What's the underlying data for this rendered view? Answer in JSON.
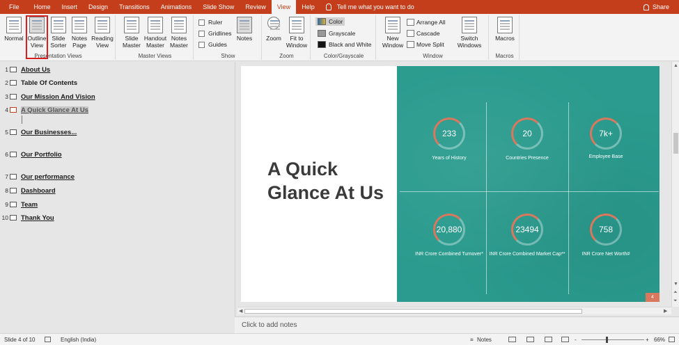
{
  "tabs": [
    "File",
    "Home",
    "Insert",
    "Design",
    "Transitions",
    "Animations",
    "Slide Show",
    "Review",
    "View",
    "Help"
  ],
  "active_tab": "View",
  "tell_me": "Tell me what you want to do",
  "share": "Share",
  "ribbon": {
    "presentation_views": {
      "label": "Presentation Views",
      "buttons": [
        "Normal",
        "Outline View",
        "Slide Sorter",
        "Notes Page",
        "Reading View"
      ]
    },
    "master_views": {
      "label": "Master Views",
      "buttons": [
        "Slide Master",
        "Handout Master",
        "Notes Master"
      ]
    },
    "show": {
      "label": "Show",
      "checkboxes": [
        "Ruler",
        "Gridlines",
        "Guides"
      ],
      "notes": "Notes"
    },
    "zoom": {
      "label": "Zoom",
      "zoom": "Zoom",
      "fit": "Fit to Window"
    },
    "color": {
      "label": "Color/Grayscale",
      "options": [
        "Color",
        "Grayscale",
        "Black and White"
      ]
    },
    "window": {
      "label": "Window",
      "new_window": "New Window",
      "arrange_all": "Arrange All",
      "cascade": "Cascade",
      "move_split": "Move Split",
      "switch_windows": "Switch Windows"
    },
    "macros": {
      "label": "Macros",
      "macros": "Macros"
    }
  },
  "outline": [
    {
      "num": "1",
      "title": "About Us"
    },
    {
      "num": "2",
      "title": "Table Of Contents"
    },
    {
      "num": "3",
      "title": "Our Mission And Vision"
    },
    {
      "num": "4",
      "title": "A Quick Glance At Us"
    },
    {
      "num": "5",
      "title": "Our Businesses..."
    },
    {
      "num": "6",
      "title": "Our Portfolio"
    },
    {
      "num": "7",
      "title": "Our performance"
    },
    {
      "num": "8",
      "title": "Dashboard"
    },
    {
      "num": "9",
      "title": "Team"
    },
    {
      "num": "10",
      "title": "Thank You"
    }
  ],
  "slide": {
    "title": "A Quick Glance At Us",
    "stats": [
      {
        "value": "233",
        "label": "Years of History"
      },
      {
        "value": "20",
        "label": "Countries Presence"
      },
      {
        "value": "7k+",
        "label": "Employee Base"
      },
      {
        "value": "20,880",
        "label": "INR Crore Combined Turnover*"
      },
      {
        "value": "23494",
        "label": "INR Crore Combined Market Cap**"
      },
      {
        "value": "758",
        "label": "INR Crore Net Worth#"
      }
    ],
    "page_number": "4"
  },
  "notes_placeholder": "Click to add notes",
  "status": {
    "slide_info": "Slide 4 of 10",
    "language": "English (India)",
    "notes": "Notes",
    "minus": "-",
    "plus": "+",
    "zoom": "66%"
  },
  "colors": {
    "accent": "#c43e1c",
    "teal": "#2a9b8e",
    "ring": "#d9785d"
  }
}
